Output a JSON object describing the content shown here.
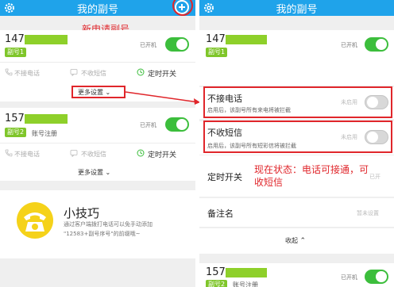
{
  "left_screen": {
    "title": "我的副号",
    "new_annotation": "新申请副号",
    "card1": {
      "number_prefix": "147",
      "tag": "副号1",
      "state": "已开机",
      "toggle_on": true,
      "actions": [
        "不接电话",
        "不收短信",
        "定时开关"
      ],
      "more": "更多设置"
    },
    "card2": {
      "number_prefix": "157",
      "tag": "副号2",
      "note": "账号注册",
      "state": "已开机",
      "toggle_on": true,
      "actions": [
        "不接电话",
        "不收短信",
        "定时开关"
      ],
      "more": "更多设置"
    },
    "tips": {
      "title": "小技巧",
      "line1": "通过客户端拨打电话可以免手动添加",
      "line2": "\"12583+副号序号\"的前缀哦~"
    }
  },
  "right_screen": {
    "title": "我的副号",
    "card": {
      "number_prefix": "147",
      "tag": "副号1",
      "state": "已开机",
      "toggle_on": true
    },
    "settings": [
      {
        "title": "不接电话",
        "desc": "启用后，该副号所有来电将被拦截",
        "right": "未启用",
        "toggle_on": false
      },
      {
        "title": "不收短信",
        "desc": "启用后，该副号所有短彩信将被拦截",
        "right": "未启用",
        "toggle_on": false
      }
    ],
    "timer": {
      "title": "定时开关",
      "right": "已开"
    },
    "remark": {
      "title": "备注名",
      "right": "暂未设置"
    },
    "collapse": "收起",
    "status_annotation_line1": "现在状态：电话可接通，可",
    "status_annotation_line2": "收短信",
    "bottom_card": {
      "number_prefix": "157",
      "tag": "副号2",
      "note": "账号注册",
      "state": "已开机",
      "toggle_on": true
    }
  },
  "colors": {
    "topbar": "#1fa3ea",
    "toggle_on": "#3cbe3c",
    "tag": "#7fc62a",
    "highlight": "#e0262b"
  }
}
